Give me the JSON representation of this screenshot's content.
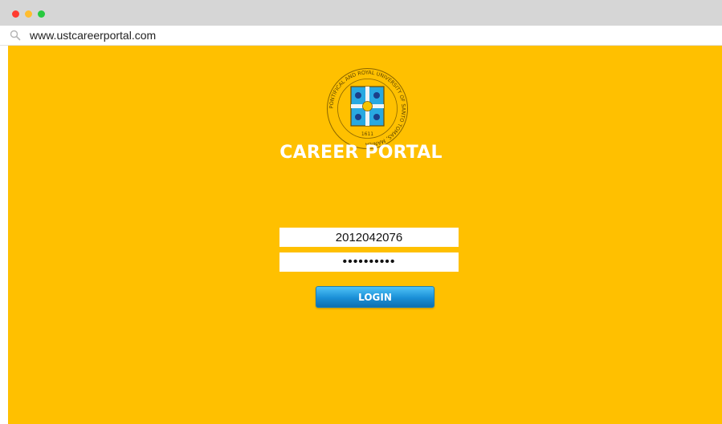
{
  "browser": {
    "url": "www.ustcareerportal.com"
  },
  "seal": {
    "ring_text": "PONTIFICAL AND ROYAL UNIVERSITY OF SANTO TOMAS, MANILA",
    "year": "1611"
  },
  "page": {
    "title": "CAREER PORTAL"
  },
  "login": {
    "username_value": "2012042076",
    "password_mask": "••••••••••",
    "button_label": "LOGIN"
  },
  "colors": {
    "background": "#ffc000",
    "button": "#1a8fd6",
    "seal_shield": "#29a9e1"
  }
}
